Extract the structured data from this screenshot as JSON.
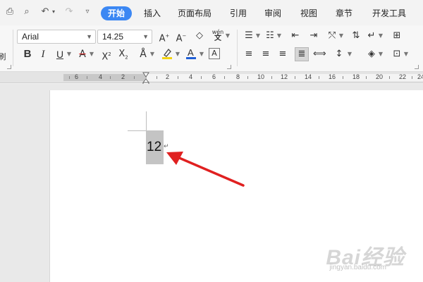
{
  "quick_access": {
    "icons": [
      "print-icon",
      "print-preview-icon",
      "undo-icon",
      "redo-icon",
      "customize-icon"
    ]
  },
  "tabs": [
    {
      "label": "开始",
      "active": true
    },
    {
      "label": "插入"
    },
    {
      "label": "页面布局"
    },
    {
      "label": "引用"
    },
    {
      "label": "审阅"
    },
    {
      "label": "视图"
    },
    {
      "label": "章节"
    },
    {
      "label": "开发工具"
    }
  ],
  "ribbon": {
    "font_name": "Arial",
    "font_size": "14.25",
    "pinyin_label": "wén",
    "left_edge_label": "刷"
  },
  "ruler": {
    "labels": [
      "6",
      "4",
      "2",
      "2",
      "4",
      "6",
      "8",
      "10",
      "12",
      "14",
      "16",
      "18",
      "20",
      "22",
      "24"
    ]
  },
  "document": {
    "text": "12",
    "paragraph_mark": "↵"
  },
  "watermark": {
    "text": "Bai经验",
    "subtext": "jingyan.baidu.com"
  },
  "colors": {
    "accent": "#3b87f3",
    "highlight_yellow": "#f3d311",
    "font_color_blue": "#1f5fd6",
    "arrow_red": "#e02020"
  }
}
